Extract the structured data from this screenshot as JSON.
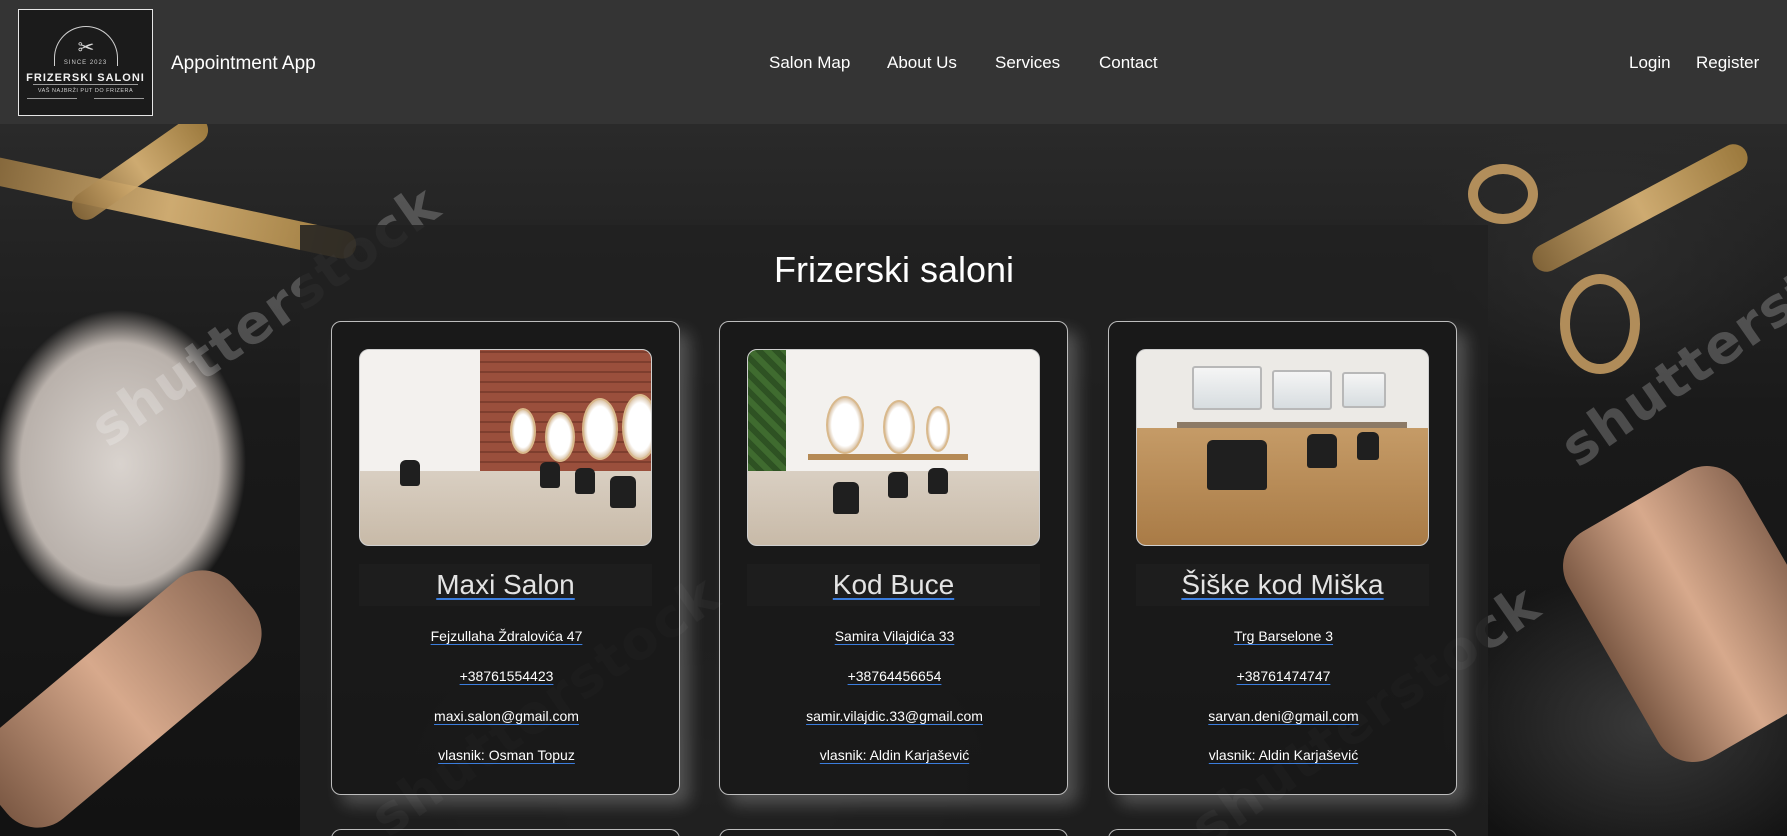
{
  "header": {
    "logo": {
      "since": "SINCE 2023",
      "name": "FRIZERSKI SALONI",
      "tagline": "VAŠ NAJBRŽI PUT DO FRIZERA"
    },
    "brand": "Appointment App",
    "nav": [
      "Salon Map",
      "About Us",
      "Services",
      "Contact"
    ],
    "auth": {
      "login": "Login",
      "register": "Register"
    }
  },
  "main": {
    "title": "Frizerski saloni",
    "salons": [
      {
        "name": "Maxi Salon",
        "address": "Fejzullaha Ždralovića 47",
        "phone": "+38761554423",
        "email": "maxi.salon@gmail.com",
        "owner": "vlasnik: Osman Topuz"
      },
      {
        "name": "Kod Buce",
        "address": "Samira Vilajdića 33",
        "phone": "+38764456654",
        "email": "samir.vilajdic.33@gmail.com",
        "owner": "vlasnik: Aldin Karjašević"
      },
      {
        "name": "Šiške kod Miška",
        "address": "Trg Barselone 3",
        "phone": "+38761474747",
        "email": "sarvan.deni@gmail.com",
        "owner": "vlasnik: Aldin Karjašević"
      }
    ]
  },
  "background": {
    "watermark": "shutterstock"
  },
  "colors": {
    "navbar": "#343434",
    "panel": "#212121",
    "link_underline": "#3b7ddd",
    "text": "#ffffff"
  },
  "icons": [
    "scissors-icon"
  ]
}
